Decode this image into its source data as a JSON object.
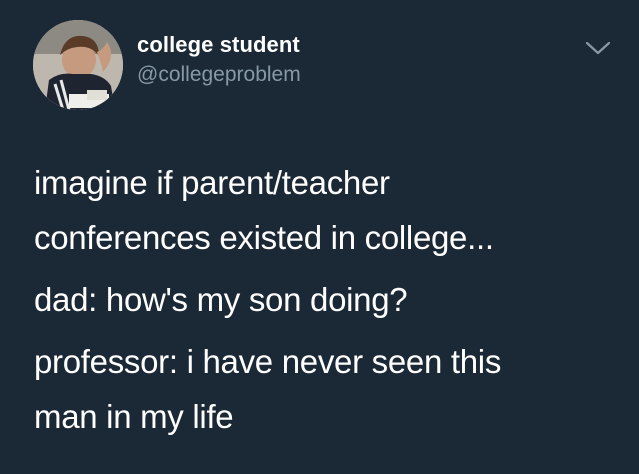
{
  "tweet": {
    "author": {
      "display_name": "college student",
      "handle": "@collegeproblem",
      "avatar_icon": "student-photo-avatar"
    },
    "menu_icon": "chevron-down-icon",
    "text": {
      "line1": "imagine if parent/teacher",
      "line2": "conferences existed in college...",
      "line3": "dad: how's my son doing?",
      "line4": "professor: i have never seen this",
      "line5": "man in my life"
    }
  },
  "colors": {
    "background": "#1b2836",
    "primary_text": "#ffffff",
    "secondary_text": "#8899a6"
  }
}
